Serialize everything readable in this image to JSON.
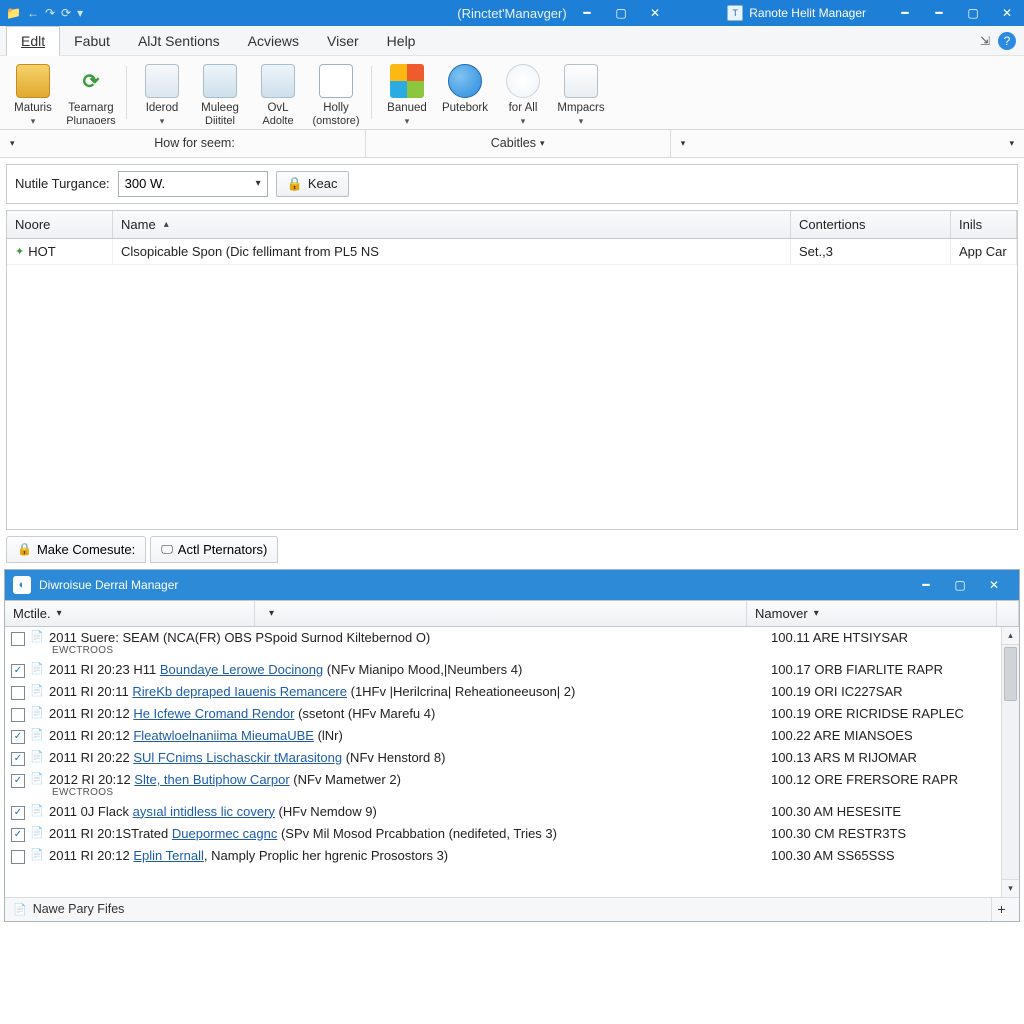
{
  "title_center": "(Rinctet'Manavger)",
  "secondary_title": "Ranote Helit Manager",
  "menubar": {
    "items": [
      "Edlt",
      "Fabut",
      "AlJt Sentions",
      "Acviews",
      "Viser",
      "Help"
    ]
  },
  "ribbon": {
    "items": [
      {
        "label": "Maturis",
        "sub": "",
        "caret": true
      },
      {
        "label": "Tearnarg",
        "sub": "Plunaoers"
      },
      {
        "label": "Iderod",
        "sub": "",
        "caret": true
      },
      {
        "label": "Muleeg",
        "sub": "Diititel"
      },
      {
        "label": "OvL",
        "sub": "Adolte"
      },
      {
        "label": "Holly",
        "sub": "(omstore)",
        "caret": true
      },
      {
        "label": "Banued",
        "sub": "",
        "caret": true
      },
      {
        "label": "Putebork",
        "sub": ""
      },
      {
        "label": "for All",
        "sub": "",
        "caret": true
      },
      {
        "label": "Mmpacrs",
        "sub": "",
        "caret": true
      }
    ],
    "footer_left": "How for seem:",
    "footer_center": "Cabitles"
  },
  "filter": {
    "label": "Nutile Turgance:",
    "value": "300 W.",
    "button": "Keac"
  },
  "grid": {
    "columns": [
      "Noore",
      "Name",
      "Contertions",
      "Inils"
    ],
    "rows": [
      {
        "a": "HOT",
        "b": "Clsopicable Spon (Dic fellimant from PL5 NS",
        "c": "Set.,3",
        "d": "App Car"
      }
    ]
  },
  "status_tabs": {
    "a": "Make Comesute:",
    "b": "Actl Pternators)"
  },
  "window2": {
    "title": "Diwroisue Derral Manager",
    "columns": {
      "a": "Mctile.",
      "b": "Namover"
    },
    "status": "Nawe Pary Fifes",
    "rows": [
      {
        "checked": false,
        "prefix": "2011 Suere:",
        "link": "",
        "link_txt": "",
        "rest": "SEAM (NCA(FR) OBS PSpoid Surnod Kiltebernod O)",
        "ex": true,
        "right": "100.11 ARE HTSIYSAR"
      },
      {
        "checked": true,
        "prefix": "2011 RI 20:23 H11",
        "link": "Boundaye Lerowe Docinong",
        "rest": " (NFv Mianipo Mood,|Neumbers 4)",
        "right": "100.17 ORB FIARLITE RAPR"
      },
      {
        "checked": false,
        "prefix": "2011 RI 20:11",
        "link": "RireKb depraped Iauenis Remancere",
        "rest": " (1HFv |Herilcrina| Reheationeeuson| 2)",
        "right": "100.19 ORI IC227SAR"
      },
      {
        "checked": false,
        "prefix": "2011 RI 20:12",
        "link": "He Icfewe Cromand Rendor",
        "rest": " (ssetont (HFv Marefu 4)",
        "right": "100.19 ORE RICRIDSE RAPLEC"
      },
      {
        "checked": true,
        "prefix": "2011 RI 20:12",
        "link": "Fleatwloelnaniima MieumaUBE",
        "rest": " (lNr)",
        "right": "100.22 ARE MIANSOES"
      },
      {
        "checked": true,
        "prefix": "2011 RI 20:22",
        "link": "SUl FCnims Lischasckir tMarasitong",
        "rest": " (NFv Henstord 8)",
        "right": "100.13 ARS M RIJOMAR"
      },
      {
        "checked": true,
        "prefix": "2012 RI 20:12",
        "link": "Slte, then Butiphow Carpor",
        "rest": " (NFv Mametwer 2)",
        "ex": true,
        "right": "100.12 ORE FRERSORE RAPR"
      },
      {
        "checked": true,
        "prefix": "2011 0J Flack",
        "link": "aysıal intidless lic covery",
        "rest": " (HFv Nemdow 9)",
        "right": "100.30 AM HESESITE"
      },
      {
        "checked": true,
        "prefix": "2011 RI 20:1STrated",
        "link": "Duepormec cagnc",
        "rest": " (SPv Mil Mosod Prcabbation (nedifeted, Tries 3)",
        "right": "100.30 CM RESTR3TS"
      },
      {
        "checked": false,
        "prefix": "2011 RI 20:12",
        "link": "Eplin Ternall",
        "rest": ", Namply Proplic her hgrenic Prosostors 3)",
        "right": "100.30 AM SS65SSS"
      }
    ]
  }
}
